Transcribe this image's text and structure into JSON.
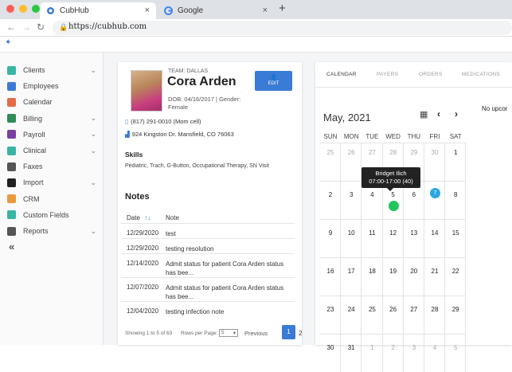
{
  "browser": {
    "tabs": [
      {
        "label": "CubHub",
        "active": true
      },
      {
        "label": "Google",
        "active": false
      }
    ],
    "url": "https://cubhub.com",
    "new_tab": "+",
    "close": "×"
  },
  "sidebar": {
    "items": [
      {
        "label": "Clients",
        "icon": "home-icon",
        "color": "#3ab5a3",
        "expandable": true
      },
      {
        "label": "Employees",
        "icon": "employees-icon",
        "color": "#3a7bd5",
        "expandable": false
      },
      {
        "label": "Calendar",
        "icon": "calendar-icon",
        "color": "#e46a4a",
        "expandable": false
      },
      {
        "label": "Billing",
        "icon": "billing-icon",
        "color": "#2e8b57",
        "expandable": true
      },
      {
        "label": "Payroll",
        "icon": "payroll-icon",
        "color": "#7a3fa0",
        "expandable": true
      },
      {
        "label": "Clinical",
        "icon": "clinical-icon",
        "color": "#3ab5a3",
        "expandable": true
      },
      {
        "label": "Faxes",
        "icon": "fax-icon",
        "color": "#555555",
        "expandable": false
      },
      {
        "label": "Import",
        "icon": "import-icon",
        "color": "#222222",
        "expandable": true
      },
      {
        "label": "CRM",
        "icon": "crm-icon",
        "color": "#e89a3c",
        "expandable": false
      },
      {
        "label": "Custom Fields",
        "icon": "custom-fields-icon",
        "color": "#3ab5a3",
        "expandable": false
      },
      {
        "label": "Reports",
        "icon": "reports-icon",
        "color": "#555555",
        "expandable": true
      }
    ],
    "collapse_label": "«"
  },
  "patient": {
    "team": "TEAM: DALLAS",
    "name": "Cora Arden",
    "dob_gender": "DOB: 04/16/2017 | Gender: Female",
    "edit_label": "EDIT",
    "phone": "(817) 291-0010 (Mom cell)",
    "address": "924 Kingston Dr. Mansfield, CO 76063",
    "skills_heading": "Skills",
    "skills": "Pediatric, Trach, G-Button, Occupational Therapy, SN Visit"
  },
  "notes": {
    "heading": "Notes",
    "col_date": "Date",
    "sort_indicator": "↑↓",
    "col_note": "Note",
    "rows": [
      {
        "date": "12/29/2020",
        "note": "test"
      },
      {
        "date": "12/29/2020",
        "note": "testing resolution"
      },
      {
        "date": "12/14/2020",
        "note": "Admit status for patient Cora Arden status has bee..."
      },
      {
        "date": "12/07/2020",
        "note": "Admit status for patient Cora Arden status has bee..."
      },
      {
        "date": "12/04/2020",
        "note": "testing infection note"
      }
    ],
    "showing": "Showing 1 to 5 of 63",
    "rows_per_page_label": "Rows per Page:",
    "rows_per_page": "5",
    "prev_label": "Previous",
    "page_current": "1",
    "page_next": "2"
  },
  "calendar": {
    "tabs": [
      "CALENDAR",
      "PAYERS",
      "ORDERS",
      "MEDICATIONS"
    ],
    "active_tab": 0,
    "month": "May, 2021",
    "no_upcoming": "No upcor",
    "weekdays": [
      "SUN",
      "MON",
      "TUE",
      "WED",
      "THU",
      "FRI",
      "SAT"
    ],
    "weeks": [
      [
        "25",
        "26",
        "27",
        "28",
        "29",
        "30",
        "1"
      ],
      [
        "2",
        "3",
        "4",
        "5",
        "6",
        "7",
        "8"
      ],
      [
        "9",
        "10",
        "11",
        "12",
        "13",
        "14",
        "15"
      ],
      [
        "16",
        "17",
        "18",
        "19",
        "20",
        "21",
        "22"
      ],
      [
        "23",
        "24",
        "25",
        "26",
        "27",
        "28",
        "29"
      ],
      [
        "30",
        "31",
        "1",
        "2",
        "3",
        "4",
        "5"
      ]
    ],
    "tooltip_name": "Bridget Ilich",
    "tooltip_time": "07:00-17:00 (40)",
    "today_badge": "7",
    "colors": {
      "event": "#21c45d",
      "today": "#2aa6e0",
      "accent": "#3a7bd5"
    }
  }
}
